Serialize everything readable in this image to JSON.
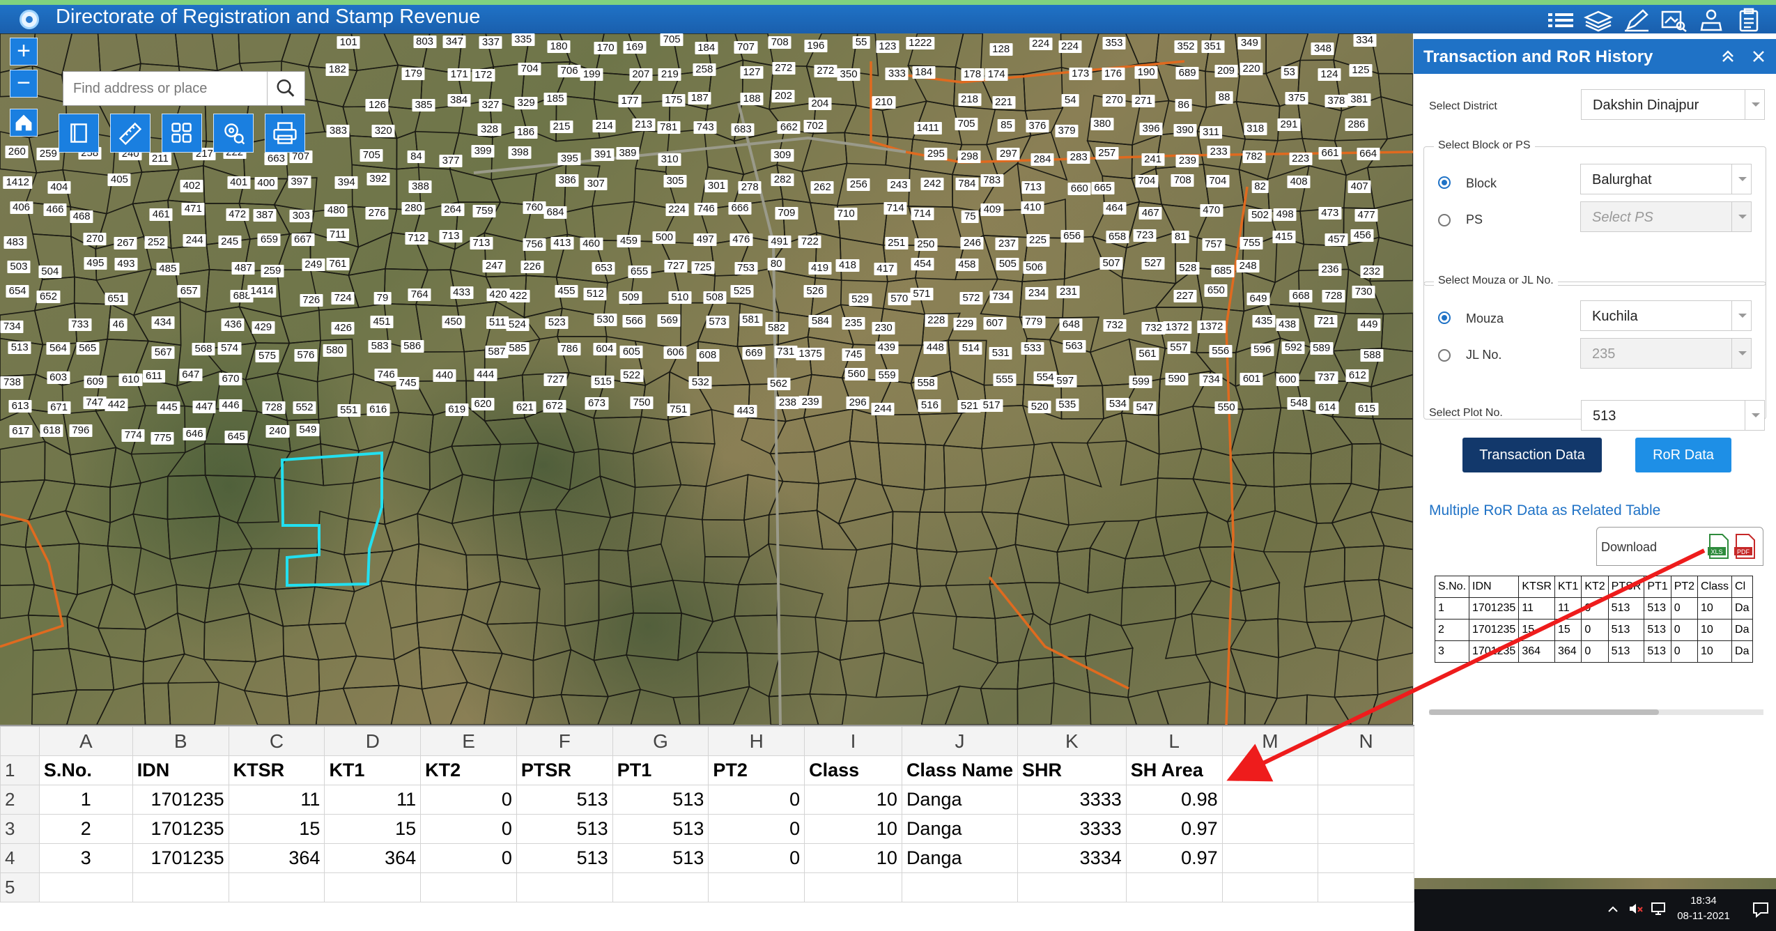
{
  "header": {
    "title": "Directorate of Registration and Stamp Revenue"
  },
  "map": {
    "search": {
      "placeholder": "Find address or place"
    },
    "zoom_in": "+",
    "zoom_out": "−"
  },
  "panel": {
    "title": "Transaction and RoR History",
    "district_label": "Select District",
    "district_value": "Dakshin Dinajpur",
    "block_group_label": "Select Block or PS",
    "block_label": "Block",
    "block_value": "Balurghat",
    "ps_label": "PS",
    "ps_placeholder": "Select PS",
    "mouza_group_label": "Select Mouza or JL No.",
    "mouza_label": "Mouza",
    "mouza_value": "Kuchila",
    "jl_label": "JL No.",
    "jl_value": "235",
    "plot_label": "Select Plot No.",
    "plot_value": "513",
    "transaction_button": "Transaction Data",
    "ror_button": "RoR Data",
    "multi_title": "Multiple RoR Data as Related Table",
    "download_label": "Download",
    "xls_label": "XLS",
    "pdf_label": "PDF",
    "colors": {
      "primary": "#1f72c6",
      "navy": "#12386b",
      "accent": "#1e8fe6"
    },
    "mini_table": {
      "headers": [
        "S.No.",
        "IDN",
        "KTSR",
        "KT1",
        "KT2",
        "PTSR",
        "PT1",
        "PT2",
        "Class",
        "Cl"
      ],
      "rows": [
        [
          "1",
          "1701235",
          "11",
          "11",
          "0",
          "513",
          "513",
          "0",
          "10",
          "Da"
        ],
        [
          "2",
          "1701235",
          "15",
          "15",
          "0",
          "513",
          "513",
          "0",
          "10",
          "Da"
        ],
        [
          "3",
          "1701235",
          "364",
          "364",
          "0",
          "513",
          "513",
          "0",
          "10",
          "Da"
        ]
      ]
    }
  },
  "sheet": {
    "columns": [
      "A",
      "B",
      "C",
      "D",
      "E",
      "F",
      "G",
      "H",
      "I",
      "J",
      "K",
      "L",
      "M",
      "N"
    ],
    "row_numbers": [
      "1",
      "2",
      "3",
      "4",
      "5"
    ],
    "headers": [
      "S.No.",
      "IDN",
      "KTSR",
      "KT1",
      "KT2",
      "PTSR",
      "PT1",
      "PT2",
      "Class",
      "Class Name",
      "SHR",
      "SH Area"
    ],
    "rows": [
      [
        "1",
        "1701235",
        "11",
        "11",
        "0",
        "513",
        "513",
        "0",
        "10",
        "Danga",
        "3333",
        "0.98"
      ],
      [
        "2",
        "1701235",
        "15",
        "15",
        "0",
        "513",
        "513",
        "0",
        "10",
        "Danga",
        "3333",
        "0.97"
      ],
      [
        "3",
        "1701235",
        "364",
        "364",
        "0",
        "513",
        "513",
        "0",
        "10",
        "Danga",
        "3334",
        "0.97"
      ]
    ]
  },
  "taskbar": {
    "time": "18:34",
    "date": "08-11-2021"
  },
  "plots": [
    "101",
    "803",
    "347",
    "337",
    "335",
    "180",
    "170",
    "169",
    "705",
    "184",
    "707",
    "708",
    "196",
    "55",
    "123",
    "1222",
    "128",
    "224",
    "224",
    "353",
    "352",
    "351",
    "349",
    "348",
    "334",
    "182",
    "179",
    "171",
    "172",
    "704",
    "706",
    "199",
    "207",
    "219",
    "258",
    "127",
    "272",
    "272",
    "350",
    "333",
    "184",
    "178",
    "174",
    "173",
    "176",
    "190",
    "689",
    "209",
    "220",
    "53",
    "124",
    "125",
    "126",
    "385",
    "384",
    "327",
    "329",
    "185",
    "177",
    "175",
    "187",
    "188",
    "202",
    "204",
    "210",
    "218",
    "221",
    "54",
    "270",
    "271",
    "86",
    "88",
    "375",
    "378",
    "381",
    "383",
    "320",
    "328",
    "186",
    "215",
    "214",
    "213",
    "781",
    "743",
    "683",
    "662",
    "702",
    "1411",
    "705",
    "85",
    "376",
    "379",
    "380",
    "396",
    "390",
    "311",
    "318",
    "291",
    "286",
    "260",
    "259",
    "258",
    "240",
    "211",
    "217",
    "222",
    "663",
    "707",
    "705",
    "84",
    "377",
    "399",
    "398",
    "395",
    "391",
    "389",
    "310",
    "309",
    "295",
    "298",
    "297",
    "284",
    "283",
    "257",
    "241",
    "239",
    "233",
    "782",
    "223",
    "661",
    "664",
    "1412",
    "404",
    "405",
    "402",
    "401",
    "400",
    "397",
    "394",
    "392",
    "388",
    "386",
    "307",
    "305",
    "301",
    "278",
    "282",
    "262",
    "256",
    "243",
    "242",
    "784",
    "783",
    "713",
    "660",
    "665",
    "704",
    "708",
    "704",
    "82",
    "408",
    "407",
    "406",
    "466",
    "468",
    "461",
    "471",
    "472",
    "387",
    "303",
    "480",
    "276",
    "280",
    "264",
    "759",
    "760",
    "684",
    "224",
    "746",
    "666",
    "709",
    "710",
    "714",
    "714",
    "75",
    "409",
    "410",
    "464",
    "467",
    "470",
    "502",
    "498",
    "473",
    "477",
    "483",
    "270",
    "267",
    "252",
    "244",
    "245",
    "659",
    "667",
    "711",
    "712",
    "713",
    "713",
    "756",
    "413",
    "460",
    "459",
    "500",
    "497",
    "476",
    "491",
    "722",
    "251",
    "250",
    "246",
    "237",
    "225",
    "656",
    "658",
    "723",
    "81",
    "757",
    "755",
    "415",
    "457",
    "456",
    "503",
    "504",
    "495",
    "493",
    "485",
    "487",
    "259",
    "249",
    "761",
    "247",
    "226",
    "653",
    "655",
    "727",
    "725",
    "753",
    "80",
    "419",
    "418",
    "417",
    "454",
    "458",
    "505",
    "506",
    "507",
    "527",
    "528",
    "685",
    "248",
    "236",
    "232",
    "654",
    "652",
    "651",
    "657",
    "688",
    "1414",
    "726",
    "724",
    "79",
    "764",
    "433",
    "420",
    "422",
    "455",
    "512",
    "509",
    "510",
    "508",
    "525",
    "526",
    "529",
    "570",
    "571",
    "572",
    "734",
    "234",
    "231",
    "227",
    "650",
    "649",
    "668",
    "728",
    "730",
    "734",
    "733",
    "46",
    "434",
    "436",
    "429",
    "426",
    "451",
    "450",
    "511",
    "524",
    "523",
    "530",
    "566",
    "569",
    "573",
    "581",
    "582",
    "584",
    "235",
    "230",
    "228",
    "229",
    "607",
    "779",
    "648",
    "732",
    "732",
    "1372",
    "1372",
    "435",
    "438",
    "721",
    "449",
    "513",
    "564",
    "565",
    "567",
    "568",
    "574",
    "575",
    "576",
    "580",
    "583",
    "586",
    "587",
    "585",
    "786",
    "604",
    "605",
    "606",
    "608",
    "669",
    "731",
    "1375",
    "745",
    "439",
    "448",
    "514",
    "531",
    "533",
    "563",
    "561",
    "557",
    "556",
    "596",
    "592",
    "589",
    "588",
    "738",
    "603",
    "609",
    "610",
    "611",
    "647",
    "670",
    "746",
    "745",
    "440",
    "444",
    "727",
    "515",
    "522",
    "532",
    "562",
    "560",
    "559",
    "558",
    "555",
    "554",
    "597",
    "599",
    "590",
    "734",
    "601",
    "600",
    "737",
    "612",
    "613",
    "671",
    "747",
    "442",
    "445",
    "447",
    "446",
    "728",
    "552",
    "551",
    "616",
    "619",
    "620",
    "621",
    "672",
    "673",
    "750",
    "751",
    "443",
    "238",
    "239",
    "296",
    "244",
    "516",
    "521",
    "517",
    "520",
    "535",
    "534",
    "547",
    "550",
    "548",
    "614",
    "615",
    "617",
    "618",
    "796",
    "774",
    "775",
    "646",
    "645",
    "240",
    "549"
  ]
}
